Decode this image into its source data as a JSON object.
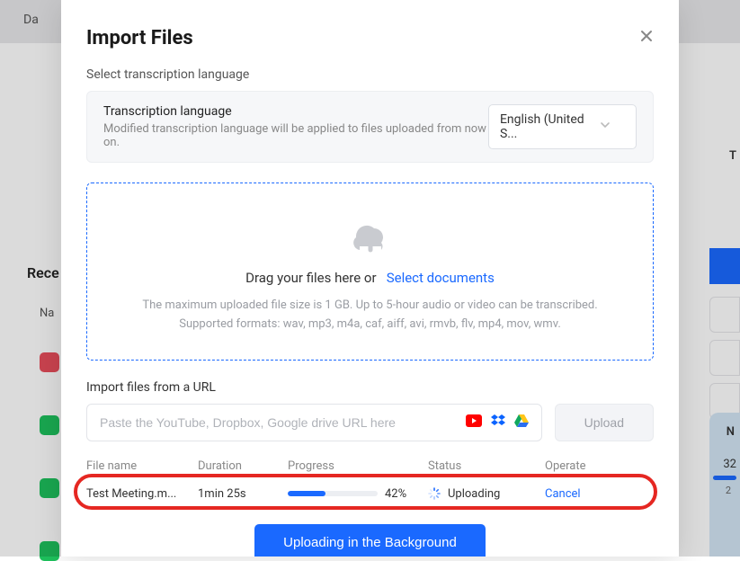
{
  "bg": {
    "nav_item": "Da",
    "rece": "Rece",
    "na": "Na",
    "right_t": "T",
    "right_n": "N",
    "right_32": "32",
    "right_2": "2"
  },
  "modal": {
    "title": "Import Files",
    "sub_label": "Select transcription language",
    "lang": {
      "title": "Transcription language",
      "sub": "Modified transcription language will be applied to files uploaded from now on.",
      "selected": "English (United S..."
    },
    "dropzone": {
      "text": "Drag your files here or",
      "link": "Select documents",
      "hint1": "The maximum uploaded file size is 1 GB. Up to 5-hour audio or video can be transcribed.",
      "hint2": "Supported formats: wav, mp3, m4a, caf, aiff, avi, rmvb, flv, mp4, mov, wmv."
    },
    "url_section": {
      "label": "Import files from a URL",
      "placeholder": "Paste the YouTube, Dropbox, Google drive URL here",
      "upload_label": "Upload"
    },
    "table": {
      "headers": {
        "name": "File name",
        "duration": "Duration",
        "progress": "Progress",
        "status": "Status",
        "operate": "Operate"
      },
      "rows": [
        {
          "name": "Test Meeting.m...",
          "duration": "1min 25s",
          "progress_pct": 42,
          "progress_label": "42%",
          "status": "Uploading",
          "operate": "Cancel"
        }
      ]
    },
    "main_button": "Uploading in the Background"
  },
  "icons": {
    "close": "close-icon",
    "chevron": "chevron-down-icon",
    "cloud": "cloud-upload-icon",
    "youtube": "youtube-icon",
    "dropbox": "dropbox-icon",
    "gdrive": "google-drive-icon",
    "spinner": "loading-spinner-icon"
  },
  "colors": {
    "primary": "#1a69ff",
    "callout": "#e52722"
  }
}
